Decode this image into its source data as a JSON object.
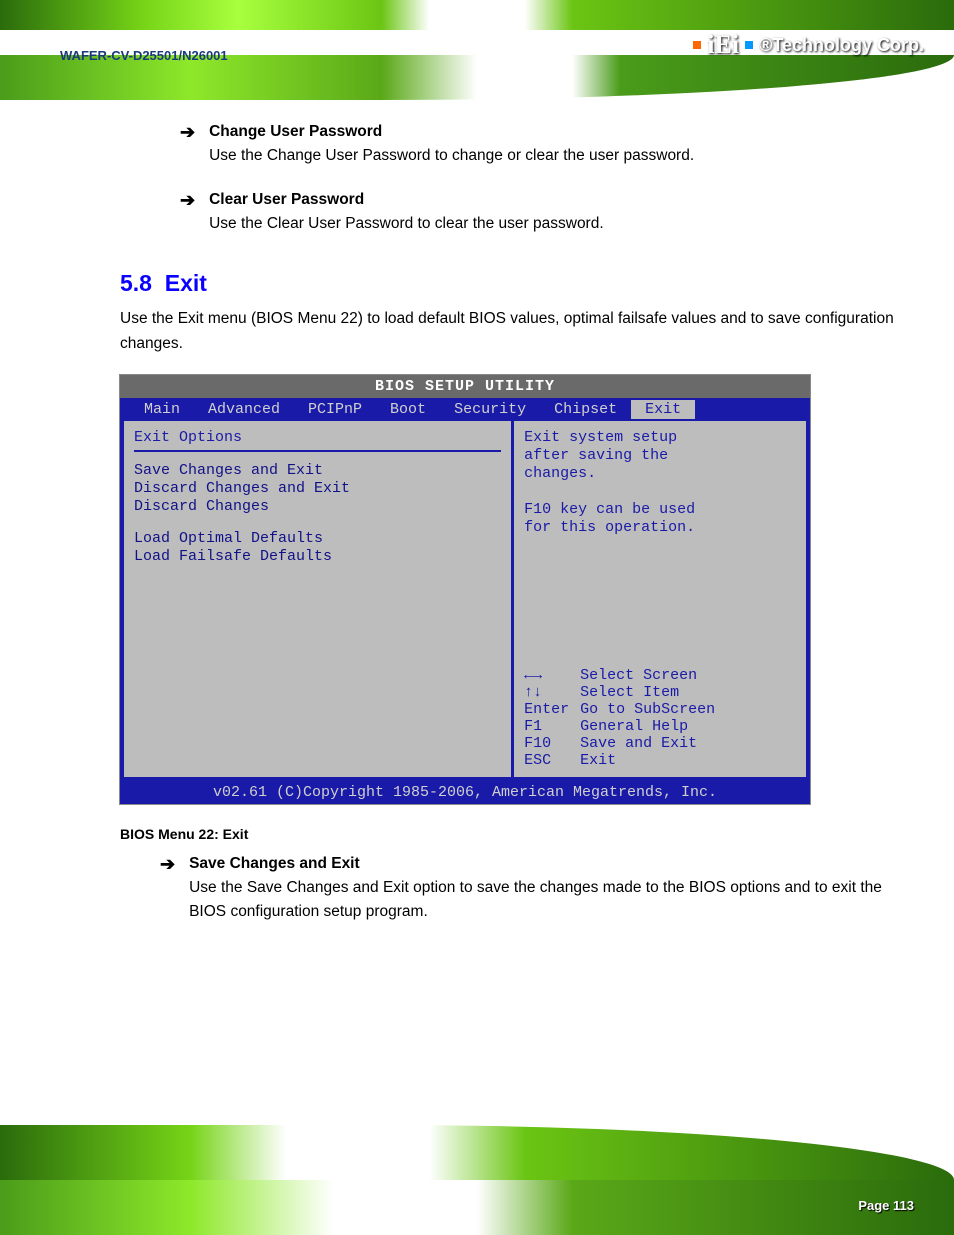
{
  "header": {
    "logo_text": "iEi",
    "logo_sub": "®Technology Corp.",
    "product": "WAFER-CV-D25501/N26001"
  },
  "bullets": {
    "b1_head": "Change User Password",
    "b1_body": "Use the Change User Password to change or clear the user password.",
    "b2_head": "Clear User Password",
    "b2_body": "Use the Clear User Password to clear the user password."
  },
  "section": {
    "number": "5.8",
    "title": "Exit",
    "para": "Use the Exit menu (BIOS Menu 22) to load default BIOS values, optimal failsafe values and to save configuration changes."
  },
  "bios": {
    "title": "BIOS SETUP UTILITY",
    "tabs": [
      "Main",
      "Advanced",
      "PCIPnP",
      "Boot",
      "Security",
      "Chipset",
      "Exit"
    ],
    "selected_tab": "Exit",
    "left_title": "Exit Options",
    "options": [
      "Save Changes and Exit",
      "Discard Changes and Exit",
      "Discard Changes",
      "",
      "Load Optimal Defaults",
      "Load Failsafe Defaults"
    ],
    "help_top": [
      "Exit system setup",
      "after saving the",
      "changes.",
      "",
      "F10 key can be used",
      "for this operation."
    ],
    "keys": [
      {
        "k": "←→",
        "d": "Select Screen"
      },
      {
        "k": "↑↓",
        "d": "Select Item"
      },
      {
        "k": "Enter",
        "d": "Go to SubScreen"
      },
      {
        "k": "F1",
        "d": "General Help"
      },
      {
        "k": "F10",
        "d": "Save and Exit"
      },
      {
        "k": "ESC",
        "d": "Exit"
      }
    ],
    "footer": "v02.61 (C)Copyright 1985-2006, American Megatrends, Inc."
  },
  "caption": "BIOS Menu 22: Exit",
  "post_bullet": {
    "head": "Save Changes and Exit",
    "body": "Use the Save Changes and Exit option to save the changes made to the BIOS options and to exit the BIOS configuration setup program."
  },
  "page": "Page 113"
}
